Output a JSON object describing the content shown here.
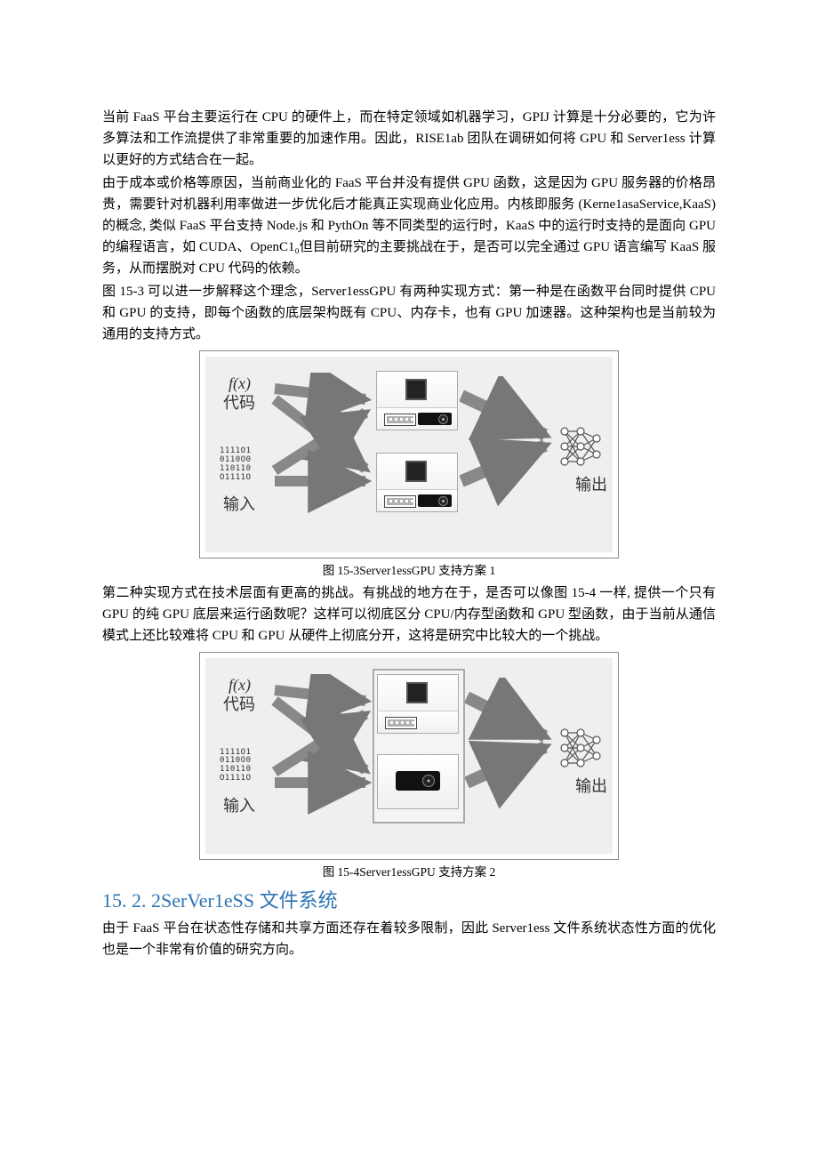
{
  "paragraphs": {
    "p1": "当前 FaaS 平台主要运行在 CPU 的硬件上，而在特定领域如机器学习，GPIJ 计算是十分必要的，它为许多算法和工作流提供了非常重要的加速作用。因此，RISE1ab 团队在调研如何将 GPU 和 Server1ess 计算以更好的方式结合在一起。",
    "p2": "由于成本或价格等原因，当前商业化的 FaaS 平台并没有提供 GPU 函数，这是因为 GPU 服务器的价格昂贵，需要针对机器利用率做进一步优化后才能真正实现商业化应用。内核即服务 (Kerne1asaService,KaaS)的概念, 类似 FaaS 平台支持 Node.js 和 PythOn 等不同类型的运行时，KaaS 中的运行时支持的是面向 GPU 的编程语言，如 CUDA、OpenC1₀但目前研究的主要挑战在于，是否可以完全通过 GPU 语言编写 KaaS 服务，从而摆脱对 CPU 代码的依赖。",
    "p3": "图 15-3 可以进一步解释这个理念，Server1essGPU 有两种实现方式：第一种是在函数平台同时提供 CPU 和 GPU 的支持，即每个函数的底层架构既有 CPU、内存卡，也有 GPU 加速器。这种架构也是当前较为通用的支持方式。",
    "p4": "第二种实现方式在技术层面有更高的挑战。有挑战的地方在于，是否可以像图 15-4 一样, 提供一个只有 GPU 的纯 GPU 底层来运行函数呢？这样可以彻底区分 CPU/内存型函数和 GPU 型函数，由于当前从通信模式上还比较难将 CPU 和 GPU 从硬件上彻底分开，这将是研究中比较大的一个挑战。",
    "p5": "由于 FaaS 平台在状态性存储和共享方面还存在着较多限制，因此 Server1ess 文件系统状态性方面的优化也是一个非常有价值的研究方向。"
  },
  "figures": {
    "fig1": {
      "fx": "f(x)",
      "code_label": "代码",
      "input_label": "输入",
      "input_symbol": "1111O1\n0110O0\n110110\nO1111O",
      "output_label": "输出",
      "caption": "图 15-3Server1essGPU 支持方案 1"
    },
    "fig2": {
      "fx": "f(x)",
      "code_label": "代码",
      "input_label": "输入",
      "input_symbol": "1111O1\n0110O0\n110110\nO1111O",
      "output_label": "输出",
      "caption": "图 15-4Server1essGPU 支持方案 2"
    }
  },
  "heading": "15. 2. 2SerVer1eSS 文件系统"
}
